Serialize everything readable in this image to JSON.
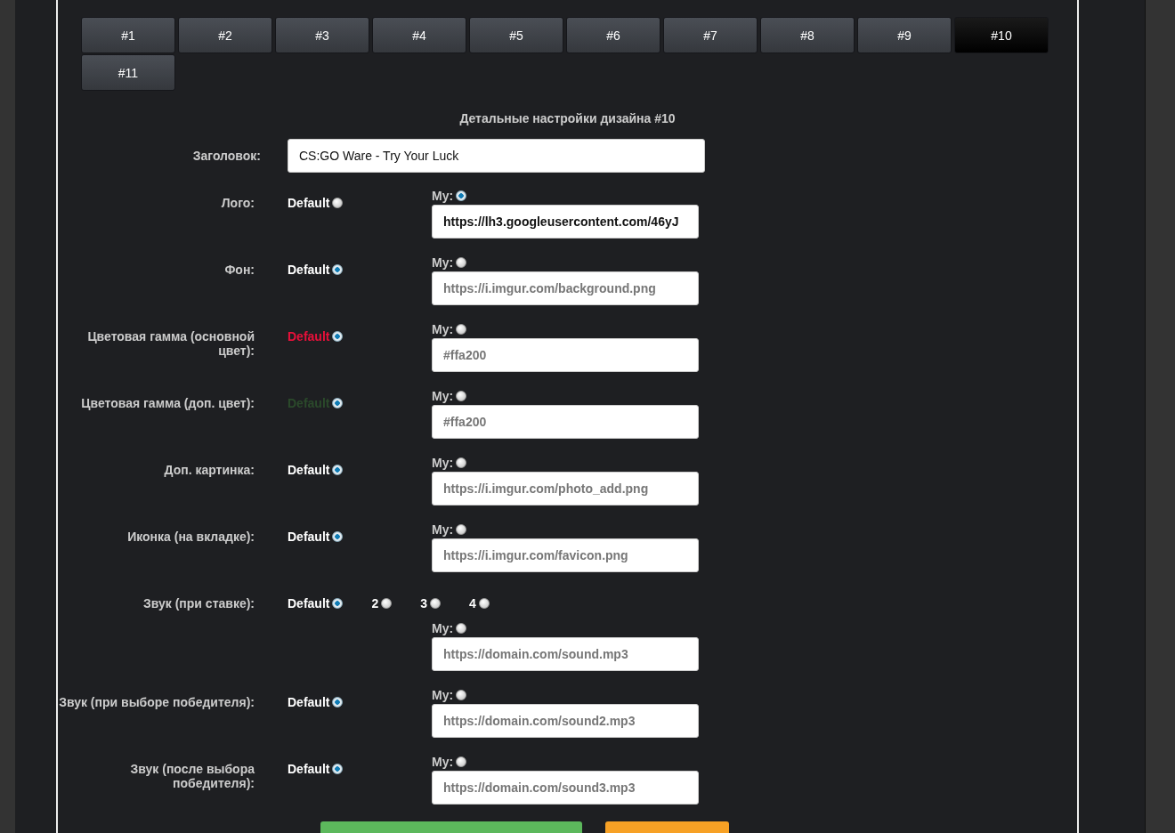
{
  "tabs": [
    {
      "label": "#1",
      "selected": false
    },
    {
      "label": "#2",
      "selected": false
    },
    {
      "label": "#3",
      "selected": false
    },
    {
      "label": "#4",
      "selected": false
    },
    {
      "label": "#5",
      "selected": false
    },
    {
      "label": "#6",
      "selected": false
    },
    {
      "label": "#7",
      "selected": false
    },
    {
      "label": "#8",
      "selected": false
    },
    {
      "label": "#9",
      "selected": false
    },
    {
      "label": "#10",
      "selected": true
    },
    {
      "label": "#11",
      "selected": false
    }
  ],
  "heading": "Детальные настройки дизайна #10",
  "title_field": {
    "label": "Заголовок:",
    "value": "CS:GO Ware - Try Your Luck"
  },
  "settings": [
    {
      "label": "Лого:",
      "default": {
        "label": "Default",
        "selected": false
      },
      "custom": {
        "label": "My:",
        "selected": true,
        "value": "https://lh3.googleusercontent.com/46yJ"
      }
    },
    {
      "label": "Фон:",
      "default": {
        "label": "Default",
        "selected": true
      },
      "custom": {
        "label": "My:",
        "selected": false,
        "placeholder": "https://i.imgur.com/background.png"
      }
    },
    {
      "label": "Цветовая гамма (основной цвет):",
      "default": {
        "label": "Default",
        "selected": true,
        "color": "#e8103a"
      },
      "custom": {
        "label": "My:",
        "selected": false,
        "placeholder": "#ffa200"
      }
    },
    {
      "label": "Цветовая гамма (доп. цвет):",
      "default": {
        "label": "Default",
        "selected": true,
        "color": "#2b4a2b"
      },
      "custom": {
        "label": "My:",
        "selected": false,
        "placeholder": "#ffa200"
      }
    },
    {
      "label": "Доп. картинка:",
      "default": {
        "label": "Default",
        "selected": true
      },
      "custom": {
        "label": "My:",
        "selected": false,
        "placeholder": "https://i.imgur.com/photo_add.png"
      }
    },
    {
      "label": "Иконка (на вкладке):",
      "default": {
        "label": "Default",
        "selected": true
      },
      "custom": {
        "label": "My:",
        "selected": false,
        "placeholder": "https://i.imgur.com/favicon.png"
      }
    },
    {
      "label": "Звук (при ставке):",
      "default": {
        "label": "Default",
        "selected": true
      },
      "extra_options": [
        {
          "label": "2",
          "selected": false
        },
        {
          "label": "3",
          "selected": false
        },
        {
          "label": "4",
          "selected": false
        }
      ],
      "custom": {
        "label": "My:",
        "selected": false,
        "placeholder": "https://domain.com/sound.mp3"
      }
    },
    {
      "label": "Звук (при выборе победителя):",
      "default": {
        "label": "Default",
        "selected": true
      },
      "custom": {
        "label": "My:",
        "selected": false,
        "placeholder": "https://domain.com/sound2.mp3"
      }
    },
    {
      "label": "Звук (после выбора победителя):",
      "default": {
        "label": "Default",
        "selected": true
      },
      "custom": {
        "label": "My:",
        "selected": false,
        "placeholder": "https://domain.com/sound3.mp3"
      }
    }
  ],
  "buttons": [
    {
      "color": "#5cb85c"
    },
    {
      "color": "#f7a125"
    }
  ]
}
